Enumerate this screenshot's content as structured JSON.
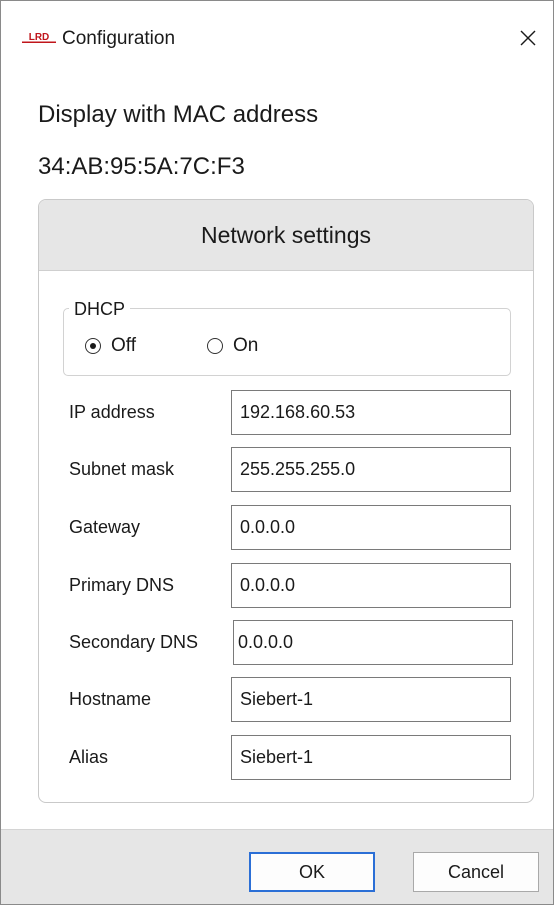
{
  "window": {
    "title": "Configuration",
    "logo_text": "LRD",
    "logo_color": "#c0151b",
    "close_icon": "close-icon"
  },
  "heading": {
    "line1": "Display with MAC address",
    "line2": "34:AB:95:5A:7C:F3"
  },
  "panel": {
    "header": "Network settings",
    "dhcp": {
      "legend": "DHCP",
      "options": [
        {
          "label": "Off",
          "selected": true
        },
        {
          "label": "On",
          "selected": false
        }
      ]
    },
    "fields": [
      {
        "label": "IP address",
        "value": "192.168.60.53"
      },
      {
        "label": "Subnet mask",
        "value": "255.255.255.0"
      },
      {
        "label": "Gateway",
        "value": "0.0.0.0"
      },
      {
        "label": "Primary DNS",
        "value": "0.0.0.0"
      },
      {
        "label": "Secondary DNS",
        "value": "0.0.0.0"
      },
      {
        "label": "Hostname",
        "value": "Siebert-1"
      },
      {
        "label": "Alias",
        "value": "Siebert-1"
      }
    ]
  },
  "footer": {
    "ok_label": "OK",
    "cancel_label": "Cancel",
    "accent": "#2b6fd6"
  }
}
